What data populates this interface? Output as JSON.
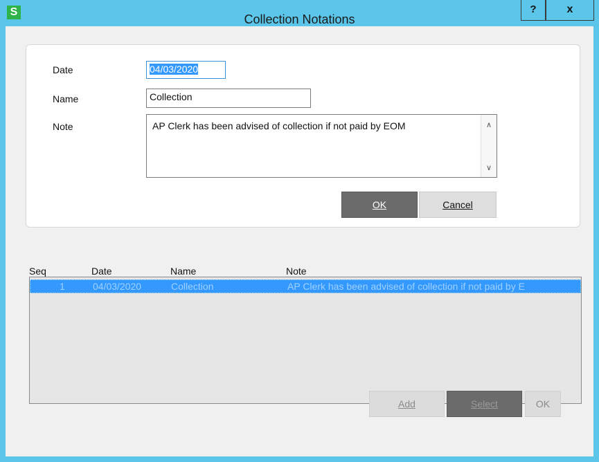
{
  "window": {
    "title": "Collection Notations",
    "app_icon": "S",
    "help_label": "?",
    "close_label": "x"
  },
  "form": {
    "date_label": "Date",
    "date_value": "04/03/2020",
    "name_label": "Name",
    "name_value": "Collection",
    "note_label": "Note",
    "note_value": "AP Clerk has been advised of collection if not paid by EOM",
    "ok_label": "OK",
    "cancel_label": "Cancel"
  },
  "list": {
    "columns": [
      "Seq",
      "Date",
      "Name",
      "Note"
    ],
    "rows": [
      {
        "seq": "1",
        "date": "04/03/2020",
        "name": "Collection",
        "note": "AP Clerk has been advised of collection if not paid by E"
      }
    ]
  },
  "footer": {
    "add_label": "Add",
    "select_label": "Select",
    "ok_label": "OK"
  },
  "icons": {
    "scroll_up": "chevron-up-icon",
    "scroll_down": "chevron-down-icon"
  },
  "colors": {
    "titlebar": "#5bc6ea",
    "selection": "#3399ff",
    "app_icon": "#2db34a"
  }
}
